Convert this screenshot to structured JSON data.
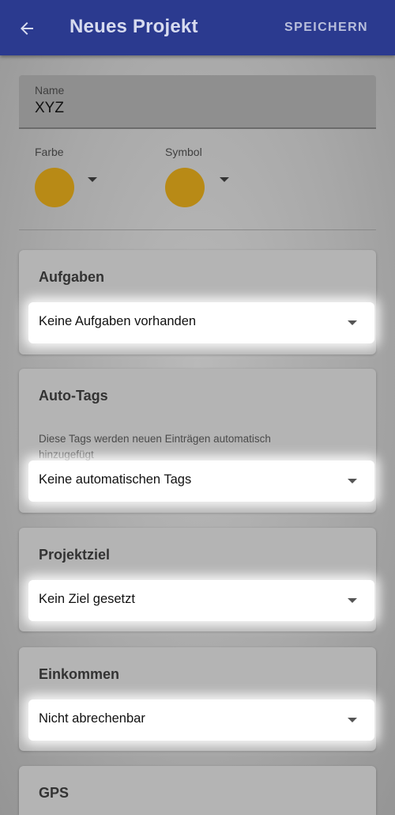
{
  "appbar": {
    "title": "Neues Projekt",
    "save_label": "SPEICHERN",
    "back_icon": "arrow-left-icon",
    "color": "#2b3a8f"
  },
  "name_field": {
    "label": "Name",
    "value": "XYZ"
  },
  "color_picker": {
    "label": "Farbe",
    "value_color": "#b88a16"
  },
  "symbol_picker": {
    "label": "Symbol",
    "value_color": "#b88a16"
  },
  "sections": {
    "tasks": {
      "title": "Aufgaben",
      "select_value": "Keine Aufgaben vorhanden"
    },
    "auto_tags": {
      "title": "Auto-Tags",
      "description": "Diese Tags werden neuen Einträgen automatisch hinzugefügt",
      "select_value": "Keine automatischen Tags"
    },
    "goal": {
      "title": "Projektziel",
      "select_value": "Kein Ziel gesetzt"
    },
    "income": {
      "title": "Einkommen",
      "select_value": "Nicht abrechenbar"
    },
    "gps": {
      "title": "GPS"
    }
  }
}
